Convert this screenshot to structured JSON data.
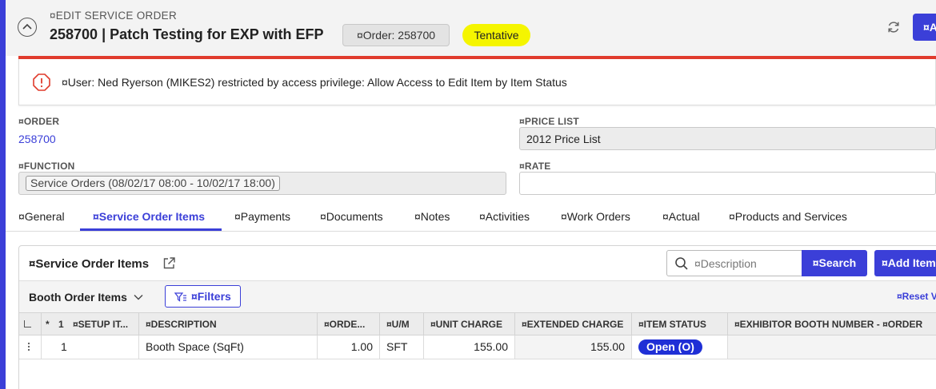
{
  "header": {
    "label": "¤EDIT SERVICE ORDER",
    "title": "258700 | Patch Testing for EXP with EFP",
    "order_chip": "¤Order: 258700",
    "status": "Tentative",
    "action_label": "¤A",
    "status_color": "#f5f500",
    "accent_color": "#3b3fd8"
  },
  "alert": {
    "icon": "warning-octagon-icon",
    "message": "¤User: Ned Ryerson (MIKES2) restricted by access privilege: Allow Access to Edit Item by Item Status",
    "color": "#e03b2c"
  },
  "fields": {
    "order_label": "¤ORDER",
    "order_value": "258700",
    "price_list_label": "¤PRICE LIST",
    "price_list_value": "2012 Price List",
    "function_label": "¤FUNCTION",
    "function_value": "Service Orders (08/02/17 08:00 - 10/02/17 18:00)",
    "rate_label": "¤RATE",
    "rate_value": ""
  },
  "tabs": [
    {
      "label": "¤General"
    },
    {
      "label": "¤Service Order Items"
    },
    {
      "label": "¤Payments"
    },
    {
      "label": "¤Documents"
    },
    {
      "label": "¤Notes"
    },
    {
      "label": "¤Activities"
    },
    {
      "label": "¤Work Orders"
    },
    {
      "label": "¤Actual"
    },
    {
      "label": "¤Products and Services"
    }
  ],
  "active_tab": "¤Service Order Items",
  "panel": {
    "title": "¤Service Order Items",
    "search_placeholder": "¤Description",
    "search_button": "¤Search",
    "add_item_button": "¤Add Item",
    "view_select": "Booth Order Items",
    "filters_button": "¤Filters",
    "reset_link": "¤Reset V"
  },
  "grid": {
    "columns": [
      "",
      "*",
      "1",
      "¤SETUP IT...",
      "¤DESCRIPTION",
      "¤ORDE...",
      "¤U/M",
      "¤UNIT CHARGE",
      "¤EXTENDED CHARGE",
      "¤ITEM STATUS",
      "¤EXHIBITOR BOOTH NUMBER - ¤ORDER"
    ],
    "rows": [
      {
        "line": "1",
        "setup_item": "",
        "description": "Booth Space (SqFt)",
        "ordered": "1.00",
        "um": "SFT",
        "unit_charge": "155.00",
        "extended_charge": "155.00",
        "item_status": "Open (O)",
        "exhibitor_booth": ""
      }
    ]
  }
}
